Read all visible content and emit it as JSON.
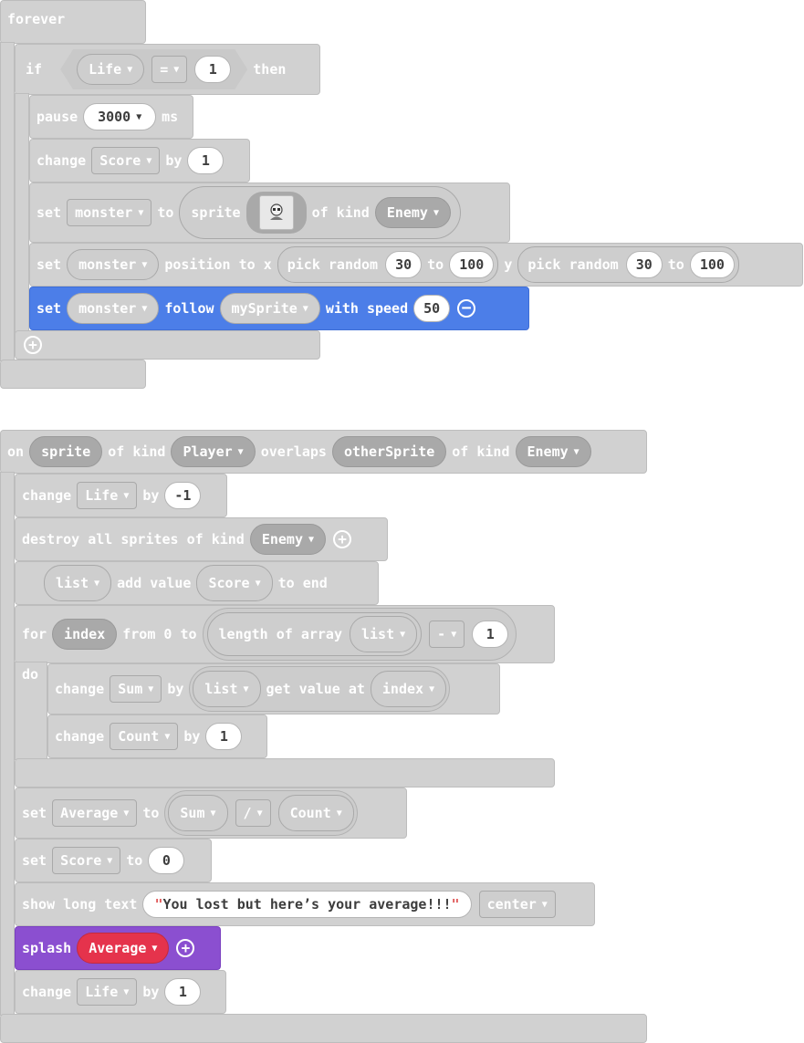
{
  "forever": {
    "label": "forever",
    "if": {
      "if_label": "if",
      "then_label": "then",
      "condition": {
        "variable": "Life",
        "operator": "=",
        "value": "1"
      }
    },
    "pause": {
      "label": "pause",
      "value": "3000",
      "unit": "ms"
    },
    "change_score": {
      "label": "change",
      "variable": "Score",
      "by": "by",
      "value": "1"
    },
    "set_monster": {
      "label": "set",
      "variable": "monster",
      "to": "to",
      "sprite": "sprite",
      "of_kind": "of kind",
      "kind": "Enemy"
    },
    "set_position": {
      "label": "set",
      "variable": "monster",
      "position_to_x": "position to x",
      "pick_random": "pick random",
      "x_min": "30",
      "to": "to",
      "x_max": "100",
      "y": "y",
      "y_min": "30",
      "y_max": "100"
    },
    "set_follow": {
      "label": "set",
      "variable": "monster",
      "follow": "follow",
      "target": "mySprite",
      "with_speed": "with speed",
      "speed": "50"
    }
  },
  "overlap": {
    "on": "on",
    "sprite": "sprite",
    "of_kind": "of kind",
    "kind1": "Player",
    "overlaps": "overlaps",
    "other": "otherSprite",
    "kind2": "Enemy",
    "change_life": {
      "label": "change",
      "variable": "Life",
      "by": "by",
      "value": "-1"
    },
    "destroy": {
      "label": "destroy all sprites of kind",
      "kind": "Enemy"
    },
    "list_add": {
      "list": "list",
      "add_value": "add value",
      "value": "Score",
      "to_end": "to end"
    },
    "for": {
      "for": "for",
      "index": "index",
      "from_0_to": "from 0 to",
      "length_of_array": "length of array",
      "list": "list",
      "operator": "-",
      "value": "1",
      "do": "do",
      "change_sum": {
        "label": "change",
        "variable": "Sum",
        "by": "by",
        "list": "list",
        "get_value_at": "get value at",
        "index": "index"
      },
      "change_count": {
        "label": "change",
        "variable": "Count",
        "by": "by",
        "value": "1"
      }
    },
    "set_average": {
      "label": "set",
      "variable": "Average",
      "to": "to",
      "a": "Sum",
      "operator": "/",
      "b": "Count"
    },
    "set_score": {
      "label": "set",
      "variable": "Score",
      "to": "to",
      "value": "0"
    },
    "show_text": {
      "label": "show long text",
      "text": "You lost but here’s your average!!!",
      "align": "center"
    },
    "splash": {
      "label": "splash",
      "variable": "Average"
    },
    "change_life2": {
      "label": "change",
      "variable": "Life",
      "by": "by",
      "value": "1"
    }
  }
}
